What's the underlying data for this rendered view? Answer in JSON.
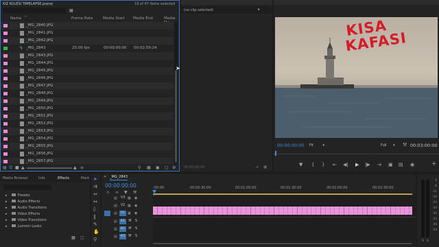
{
  "project": {
    "tab_label": "KIZ KULESI TIMELAPSE.prproj",
    "selection_status": "19 of 47 items selected",
    "columns": [
      "Name",
      "Frame Rate",
      "Media Start",
      "Media End",
      "Media Du"
    ],
    "rows": [
      {
        "name": "_MG_2840.JPG",
        "fps": "",
        "start": "",
        "end": "",
        "color": "#e98ad7"
      },
      {
        "name": "_MG_2841.JPG",
        "fps": "",
        "start": "",
        "end": "",
        "color": "#e98ad7"
      },
      {
        "name": "_MG_2842.JPG",
        "fps": "",
        "start": "",
        "end": "",
        "color": "#e98ad7"
      },
      {
        "name": "_MG_2843",
        "fps": "25.00 fps",
        "start": "00:00:00:00",
        "end": "00:02:59:24",
        "color": "#3fae53",
        "is_sequence": true
      },
      {
        "name": "_MG_2843.JPG",
        "fps": "",
        "start": "",
        "end": "",
        "color": "#e98ad7"
      },
      {
        "name": "_MG_2844.JPG",
        "fps": "",
        "start": "",
        "end": "",
        "color": "#e98ad7"
      },
      {
        "name": "_MG_2845.JPG",
        "fps": "",
        "start": "",
        "end": "",
        "color": "#e98ad7"
      },
      {
        "name": "_MG_2846.JPG",
        "fps": "",
        "start": "",
        "end": "",
        "color": "#e98ad7"
      },
      {
        "name": "_MG_2847.JPG",
        "fps": "",
        "start": "",
        "end": "",
        "color": "#e98ad7"
      },
      {
        "name": "_MG_2848.JPG",
        "fps": "",
        "start": "",
        "end": "",
        "color": "#e98ad7"
      },
      {
        "name": "_MG_2849.JPG",
        "fps": "",
        "start": "",
        "end": "",
        "color": "#e98ad7"
      },
      {
        "name": "_MG_2850.JPG",
        "fps": "",
        "start": "",
        "end": "",
        "color": "#e98ad7"
      },
      {
        "name": "_MG_2851.JPG",
        "fps": "",
        "start": "",
        "end": "",
        "color": "#e98ad7"
      },
      {
        "name": "_MG_2852.JPG",
        "fps": "",
        "start": "",
        "end": "",
        "color": "#e98ad7"
      },
      {
        "name": "_MG_2853.JPG",
        "fps": "",
        "start": "",
        "end": "",
        "color": "#e98ad7"
      },
      {
        "name": "_MG_2854.JPG",
        "fps": "",
        "start": "",
        "end": "",
        "color": "#e98ad7"
      },
      {
        "name": "_MG_2855.JPG",
        "fps": "",
        "start": "",
        "end": "",
        "color": "#e98ad7"
      },
      {
        "name": "_MG_2856.JPG",
        "fps": "",
        "start": "",
        "end": "",
        "color": "#e98ad7"
      },
      {
        "name": "_MG_2857.JPG",
        "fps": "",
        "start": "",
        "end": "",
        "color": "#e98ad7"
      }
    ]
  },
  "source": {
    "no_clip": "(no clip selected)",
    "timecode": "00:00:00:00"
  },
  "program": {
    "watermark_line1": "KISA",
    "watermark_line2": "KAFASI",
    "timecode": "00:00:00:00",
    "fit": "Fit",
    "quality": "Full",
    "duration": "00:03:00:00"
  },
  "effects_panel": {
    "tabs": [
      "Media Browser",
      "Info",
      "Effects",
      "Mark"
    ],
    "active_tab": "Effects",
    "items": [
      "Presets",
      "Audio Effects",
      "Audio Transitions",
      "Video Effects",
      "Video Transitions",
      "Lumetri Looks"
    ]
  },
  "timeline": {
    "sequence_tab": "_MG_2843",
    "timecode": "00:00:00:00",
    "ruler": [
      ":00:00",
      "00:00:30:00",
      "00:01:00:00",
      "00:01:30:00",
      "00:02:00:00",
      "00:02:30:00"
    ],
    "video_tracks": [
      "V3",
      "V2",
      "V1"
    ],
    "audio_tracks": [
      "A1",
      "A2",
      "A3"
    ],
    "track_m": "M",
    "track_s": "S"
  },
  "meter": {
    "labels": [
      "0",
      "-6",
      "-12",
      "-18",
      "-24",
      "-30",
      "-36",
      "-42",
      "-48",
      "-54"
    ],
    "footer": "S"
  },
  "colors": {
    "accent": "#3d8fe6",
    "clip_pink": "#e894dc",
    "sequence_green": "#3fae53",
    "watermark_red": "#d41c2a"
  }
}
